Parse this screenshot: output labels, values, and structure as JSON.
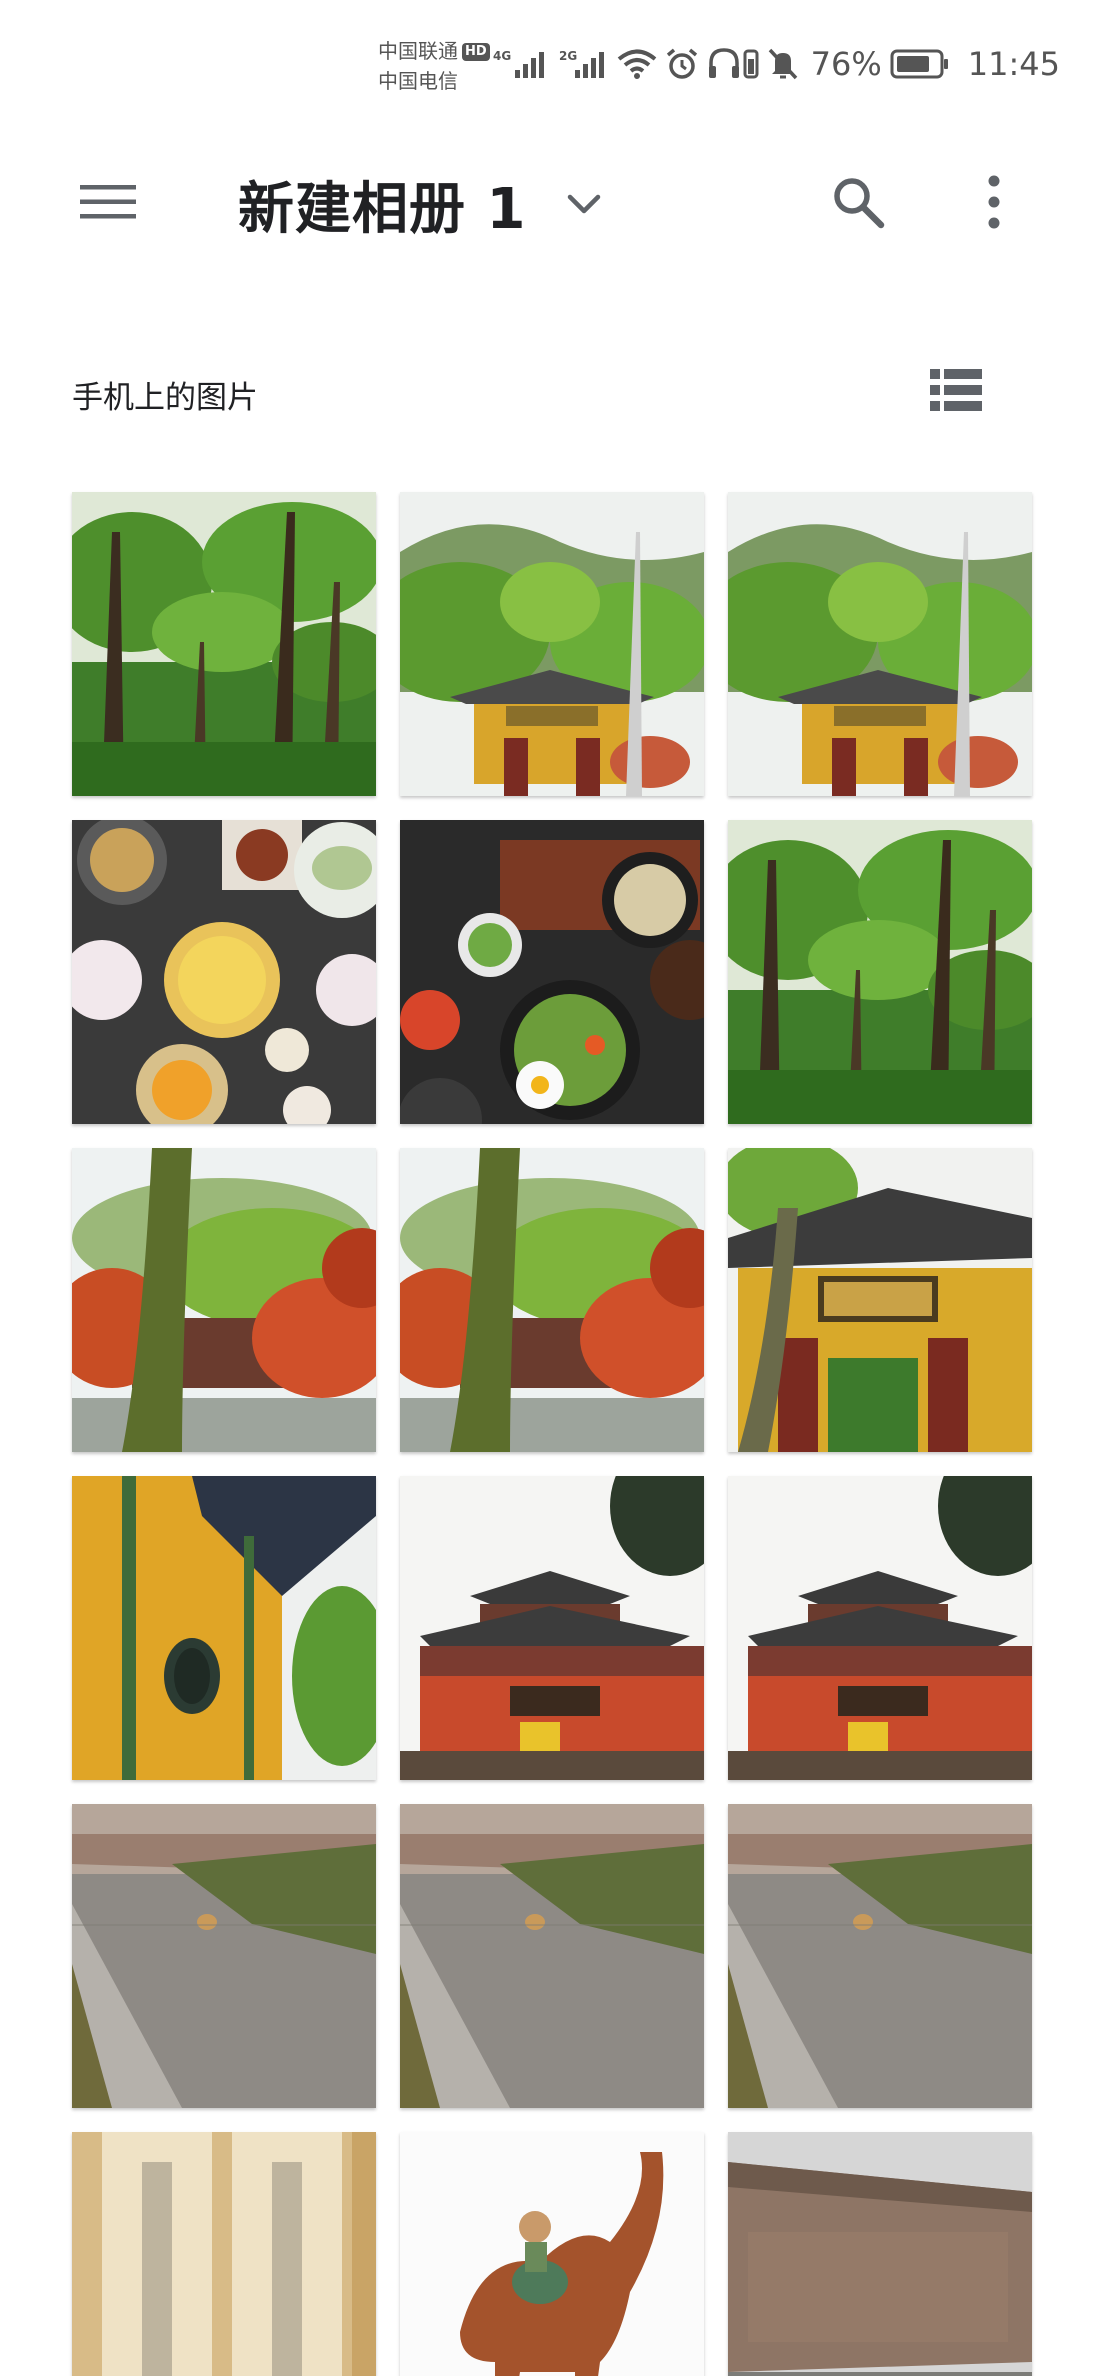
{
  "status_bar": {
    "carrier_1": "中国联通",
    "carrier_1_badge": "HD",
    "carrier_2": "中国电信",
    "network_1": "4G",
    "network_2": "2G",
    "battery": "76%",
    "time": "11:45",
    "icons": [
      "signal-4g-icon",
      "signal-2g-icon",
      "wifi-icon",
      "alarm-icon",
      "headphones-icon",
      "mute-icon",
      "battery-icon"
    ]
  },
  "app_bar": {
    "title": "新建相册 1",
    "icons": {
      "menu": "hamburger-menu-icon",
      "dropdown": "chevron-down-icon",
      "search": "search-icon",
      "more": "more-vert-icon"
    }
  },
  "section": {
    "title": "手机上的图片",
    "view_toggle_icon": "list-view-icon"
  },
  "photos": [
    {
      "scene": "forest-trees"
    },
    {
      "scene": "temple-gate-mountain"
    },
    {
      "scene": "temple-gate-mountain"
    },
    {
      "scene": "food-table-dishes"
    },
    {
      "scene": "food-bibimbap"
    },
    {
      "scene": "forest-trees"
    },
    {
      "scene": "red-maple-courtyard"
    },
    {
      "scene": "red-maple-courtyard"
    },
    {
      "scene": "temple-gate-plaque"
    },
    {
      "scene": "yellow-wall-round-window"
    },
    {
      "scene": "pavilion-hall"
    },
    {
      "scene": "pavilion-hall"
    },
    {
      "scene": "path-with-snail"
    },
    {
      "scene": "path-with-snail"
    },
    {
      "scene": "path-with-snail"
    },
    {
      "scene": "calligraphy-scroll"
    },
    {
      "scene": "tang-camel-sculpture"
    },
    {
      "scene": "memorial-wall"
    }
  ]
}
